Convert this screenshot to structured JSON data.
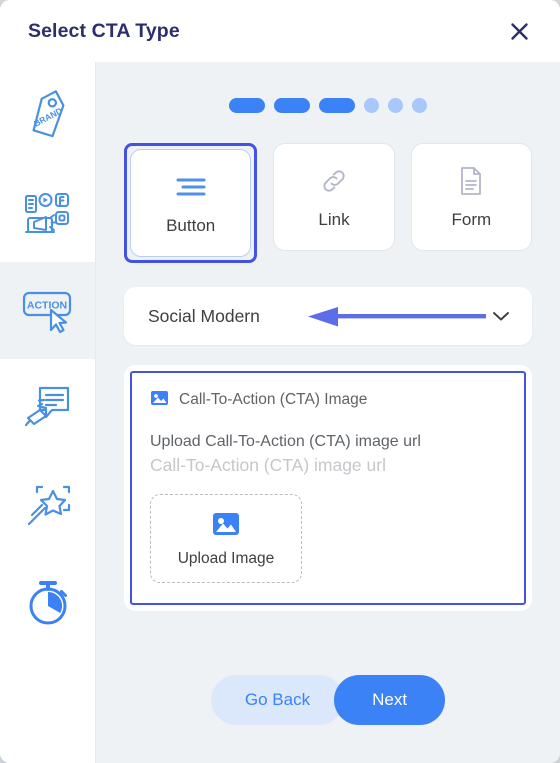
{
  "header": {
    "title": "Select CTA Type",
    "close_icon": "close-icon"
  },
  "sidebar": {
    "items": [
      {
        "id": "brand",
        "icon": "brand-tag-icon",
        "label": "BRAND",
        "active": false
      },
      {
        "id": "social",
        "icon": "social-marketing-icon",
        "label": "",
        "active": false
      },
      {
        "id": "action",
        "icon": "action-cursor-icon",
        "label": "ACTION",
        "active": true
      },
      {
        "id": "message",
        "icon": "announcement-bubble-icon",
        "label": "",
        "active": false
      },
      {
        "id": "magic",
        "icon": "magic-wand-icon",
        "label": "",
        "active": false
      },
      {
        "id": "timer",
        "icon": "stopwatch-icon",
        "label": "",
        "active": false
      }
    ]
  },
  "steps": {
    "total": 6,
    "completed": 3,
    "states": [
      "filled",
      "filled",
      "filled",
      "empty",
      "empty",
      "empty"
    ]
  },
  "cta_types": [
    {
      "id": "button",
      "label": "Button",
      "icon": "menu-lines-icon",
      "selected": true
    },
    {
      "id": "link",
      "label": "Link",
      "icon": "chain-link-icon",
      "selected": false
    },
    {
      "id": "form",
      "label": "Form",
      "icon": "document-icon",
      "selected": false
    }
  ],
  "style_select": {
    "value": "Social Modern",
    "chevron_icon": "chevron-down-icon"
  },
  "annotation": {
    "arrow_icon": "arrow-left-annotation",
    "color": "#5b6ee8"
  },
  "image_panel": {
    "heading": "Call-To-Action (CTA) Image",
    "heading_icon": "image-icon",
    "url_label": "Upload Call-To-Action (CTA) image url",
    "url_placeholder": "Call-To-Action (CTA) image url",
    "url_value": "",
    "dropzone": {
      "label": "Upload Image",
      "icon": "image-icon"
    }
  },
  "footer": {
    "back_label": "Go Back",
    "next_label": "Next"
  },
  "colors": {
    "accent_blue": "#3b82f6",
    "selection_indigo": "#4353e0",
    "title_navy": "#2c2f6b",
    "panel_bg": "#eef2f5",
    "back_btn_bg": "#dbe8fb",
    "step_empty": "#a8c7fa"
  }
}
